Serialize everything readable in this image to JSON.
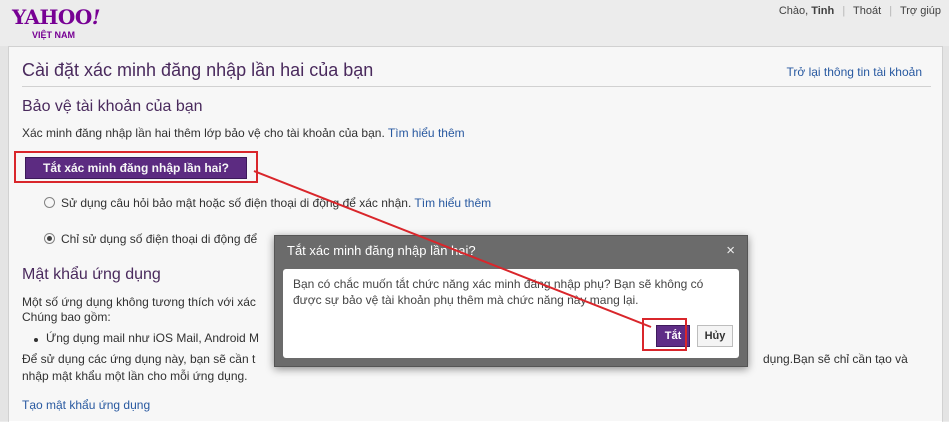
{
  "header": {
    "logo_text": "YAHOO",
    "logo_bang": "!",
    "logo_region": "VIỆT NAM",
    "greeting": "Chào,",
    "user_name": "Tinh",
    "signout": "Thoát",
    "help": "Trợ giúp"
  },
  "page": {
    "title": "Cài đặt xác minh đăng nhập lần hai của bạn",
    "back_link": "Trở lại thông tin tài khoản"
  },
  "protect": {
    "heading": "Bảo vệ tài khoản của bạn",
    "description": "Xác minh đăng nhập lần hai thêm lớp bảo vệ cho tài khoản của bạn.",
    "learn_more": "Tìm hiểu thêm",
    "disable_button": "Tắt xác minh đăng nhập lần hai?",
    "options": [
      {
        "label": "Sử dụng câu hỏi bảo mật hoặc số điện thoại di động để xác nhận.",
        "link": "Tìm hiểu thêm",
        "selected": false
      },
      {
        "label": "Chỉ sử dụng số điện thoại di động để",
        "selected": true
      }
    ]
  },
  "app_passwords": {
    "heading": "Mật khẩu ứng dụng",
    "intro_line1": "Một số ứng dụng không tương thích với xác",
    "intro_line2": "Chúng bao gồm:",
    "list_item": "Ứng dụng mail như iOS Mail, Android M",
    "usage_line1_start": "Để sử dụng các ứng dụng này, bạn sẽ cần t",
    "usage_line1_end": "dụng.Bạn sẽ chỉ cần tạo và",
    "usage_line2": "nhập mật khẩu một lần cho mỗi ứng dụng.",
    "create_link": "Tạo mật khẩu ứng dụng"
  },
  "dialog": {
    "title": "Tắt xác minh đăng nhập lần hai?",
    "close": "×",
    "message": "Bạn có chắc muốn tắt chức năng xác minh đăng nhập phụ? Bạn sẽ không có được sự bảo vệ tài khoản phụ thêm mà chức năng này mang lại.",
    "confirm": "Tắt",
    "cancel": "Hủy"
  },
  "colors": {
    "brand": "#7b0099",
    "button": "#5f2d86",
    "link": "#2a5ca6",
    "annotation": "#d9262b"
  }
}
